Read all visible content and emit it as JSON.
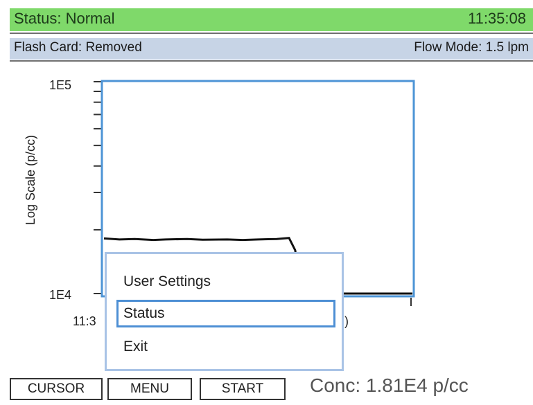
{
  "status_bar": {
    "status": "Status: Normal",
    "time": "11:35:08"
  },
  "info_bar": {
    "flash_card": "Flash Card: Removed",
    "flow_mode": "Flow Mode: 1.5 lpm"
  },
  "chart_data": {
    "type": "line",
    "ylabel": "Log Scale (p/cc)",
    "yscale": "log",
    "ylim": [
      10000,
      100000
    ],
    "y_tick_labels": [
      "1E5",
      "1E4"
    ],
    "x_tick_labels": [
      "11:3",
      ")"
    ],
    "series": [
      {
        "points": [
          [
            0,
            18200
          ],
          [
            0.05,
            18000
          ],
          [
            0.1,
            18100
          ],
          [
            0.16,
            17900
          ],
          [
            0.2,
            18000
          ],
          [
            0.27,
            18100
          ],
          [
            0.32,
            17950
          ],
          [
            0.4,
            18000
          ],
          [
            0.45,
            17900
          ],
          [
            0.5,
            18000
          ],
          [
            0.56,
            18100
          ],
          [
            0.6,
            18300
          ],
          [
            0.62,
            16000
          ],
          [
            0.64,
            10000
          ],
          [
            0.8,
            10000
          ],
          [
            1.0,
            10000
          ]
        ]
      }
    ],
    "colors": {
      "plot_border": "#4d94d6",
      "line": "#111111"
    }
  },
  "menu": {
    "items": [
      {
        "label": "User Settings",
        "selected": false
      },
      {
        "label": "Status",
        "selected": true
      },
      {
        "label": "Exit",
        "selected": false
      }
    ]
  },
  "softkeys": {
    "cursor": "CURSOR",
    "menu": "MENU",
    "start": "START"
  },
  "concentration": "Conc: 1.81E4 p/cc",
  "colors": {
    "status_bar": "#7fd96a",
    "info_bar": "#c7d4e6",
    "selection": "#4d8fd4"
  }
}
